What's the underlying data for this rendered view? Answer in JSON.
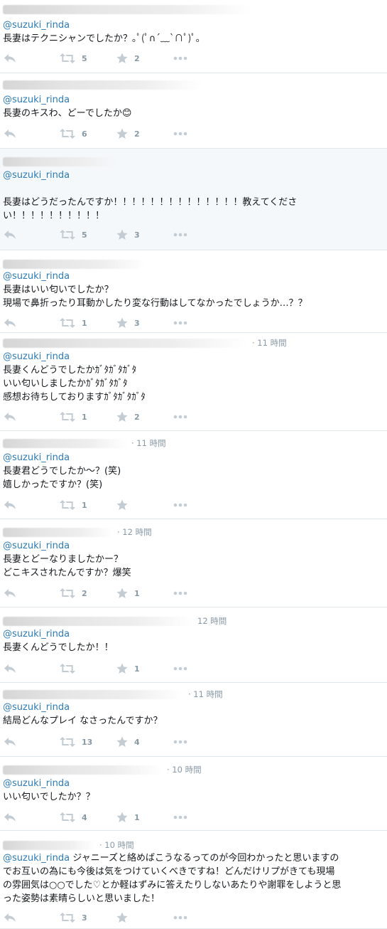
{
  "tweets": [
    {
      "time": "",
      "mention": "@suzuki_rinda",
      "text": "長妻はテクニシャンでしたか？｡ﾟ(ﾟ∩´﹏`∩ﾟ)ﾟ｡",
      "retweets": "5",
      "likes": "2"
    },
    {
      "time": "",
      "mention": "@suzuki_rinda",
      "text": "長妻のキスわ、どーでしたか😊",
      "retweets": "6",
      "likes": "2"
    },
    {
      "time": "",
      "mention": "@suzuki_rinda",
      "text": "\n長妻はどうだったんですか！！！！！！！！！！！！！！教えてくださ\nい！！！！！！！！！！",
      "retweets": "5",
      "likes": "3"
    },
    {
      "time": "",
      "mention": "@suzuki_rinda",
      "text": "長妻はいい匂いでしたか？\n現場で鼻折ったり耳動かしたり変な行動はしてなかったでしょうか…？？",
      "retweets": "1",
      "likes": "3"
    },
    {
      "time": "· 11 時間",
      "mention": "@suzuki_rinda",
      "text": "長妻くんどうでしたかｶﾞﾀｶﾞﾀｶﾞﾀ\nいい匂いしましたかｶﾞﾀｶﾞﾀｶﾞﾀ\n感想お待ちしておりますｶﾞﾀｶﾞﾀｶﾞﾀ",
      "retweets": "1",
      "likes": "2"
    },
    {
      "time": "· 11 時間",
      "mention": "@suzuki_rinda",
      "text": "長妻君どうでしたか～？(笑)\n嬉しかったですか？(笑)",
      "retweets": "1",
      "likes": ""
    },
    {
      "time": "· 12 時間",
      "mention": "@suzuki_rinda",
      "text": "長妻とどーなりましたかー？\nどこキスされたんですか？爆笑",
      "retweets": "2",
      "likes": "1"
    },
    {
      "time": "12 時間",
      "mention": "@suzuki_rinda",
      "text": "長妻くんどうでしたか！！",
      "retweets": "",
      "likes": "1"
    },
    {
      "time": "· 11 時間",
      "mention": "@suzuki_rinda",
      "text": "結局どんなプレイ なさったんですか？",
      "retweets": "13",
      "likes": "4"
    },
    {
      "time": "· 10 時間",
      "mention": "@suzuki_rinda",
      "text": "いい匂いでしたか？？",
      "retweets": "4",
      "likes": "1"
    },
    {
      "time": "· 10 時間",
      "mention": "@suzuki_rinda",
      "text": " ジャニーズと絡めばこうなるってのが今回わかったと思いますの\nでお互いの為にも今後は気をつけていくべきですね！どんだけリプがきても現場\nの雰囲気は○○でした♡とか軽はずみに答えたりしないあたりや謝罪をしようと思\nった姿勢は素晴らしいと思いました！",
      "retweets": "3",
      "likes": ""
    }
  ],
  "icons": {
    "reply": "reply-icon",
    "retweet": "retweet-icon",
    "like": "star-icon",
    "more": "more-icon"
  },
  "colors": {
    "mention": "#2b7bb9",
    "icon": "#aab8c2",
    "highlight": "#f5f8fa"
  }
}
